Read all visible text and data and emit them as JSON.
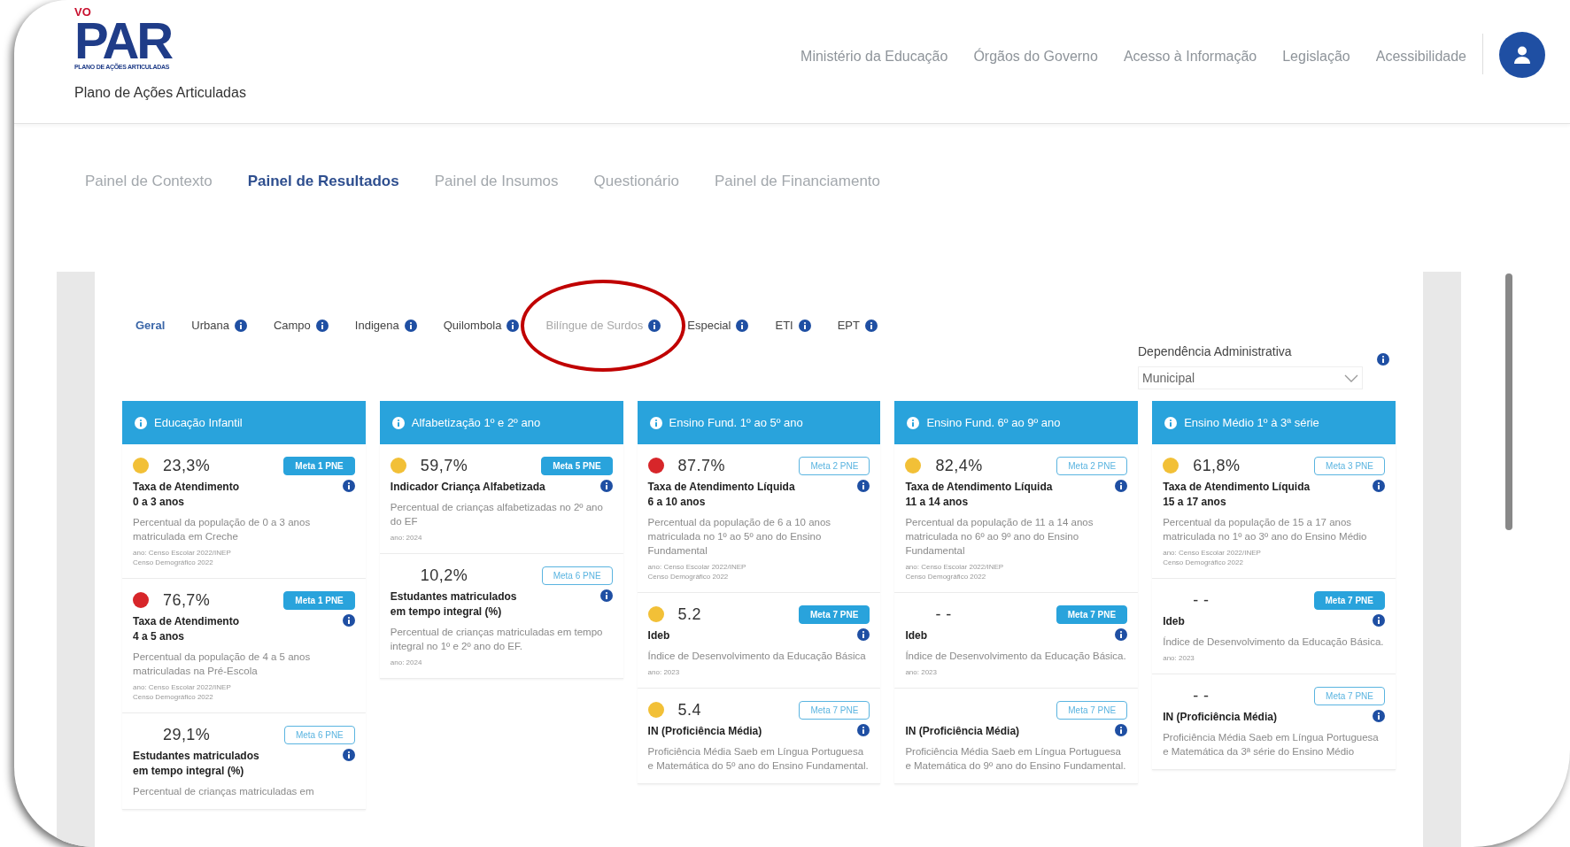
{
  "header": {
    "logo": {
      "top": "VO",
      "main": "PAR",
      "sub": "PLANO DE AÇÕES ARTICULADAS"
    },
    "subtitle": "Plano de Ações Articuladas",
    "nav_links": [
      "Ministério da Educação",
      "Órgãos do Governo",
      "Acesso à Informação",
      "Legislação",
      "Acessibilidade"
    ]
  },
  "tabs": [
    {
      "label": "Painel de Contexto",
      "selected": false
    },
    {
      "label": "Painel de Resultados",
      "selected": true
    },
    {
      "label": "Painel de Insumos",
      "selected": false
    },
    {
      "label": "Questionário",
      "selected": false
    },
    {
      "label": "Painel de Financiamento",
      "selected": false
    }
  ],
  "filters": [
    {
      "label": "Geral",
      "selected": true,
      "disabled": false,
      "info": false,
      "circled": false
    },
    {
      "label": "Urbana",
      "selected": false,
      "disabled": false,
      "info": true,
      "circled": false
    },
    {
      "label": "Campo",
      "selected": false,
      "disabled": false,
      "info": true,
      "circled": false
    },
    {
      "label": "Indigena",
      "selected": false,
      "disabled": false,
      "info": true,
      "circled": false
    },
    {
      "label": "Quilombola",
      "selected": false,
      "disabled": false,
      "info": true,
      "circled": false
    },
    {
      "label": "Bilíngue de Surdos",
      "selected": false,
      "disabled": true,
      "info": true,
      "circled": true
    },
    {
      "label": "Especial",
      "selected": false,
      "disabled": false,
      "info": true,
      "circled": false
    },
    {
      "label": "ETI",
      "selected": false,
      "disabled": false,
      "info": true,
      "circled": false
    },
    {
      "label": "EPT",
      "selected": false,
      "disabled": false,
      "info": true,
      "circled": false
    }
  ],
  "dependency": {
    "label": "Dependência Administrativa",
    "value": "Municipal"
  },
  "columns": [
    {
      "title": "Educação Infantil",
      "indicators": [
        {
          "color": "#f2c037",
          "value": "23,3%",
          "meta": "Meta 1 PNE",
          "meta_filled": true,
          "title_lines": [
            "Taxa de Atendimento",
            "0 a 3 anos"
          ],
          "description": "Percentual da população de 0 a 3 anos matriculada em Creche",
          "source_lines": [
            "ano: Censo Escolar 2022/INEP",
            "Censo Demográfico 2022"
          ]
        },
        {
          "color": "#d7262a",
          "value": "76,7%",
          "meta": "Meta 1 PNE",
          "meta_filled": true,
          "title_lines": [
            "Taxa de Atendimento",
            "4 a 5 anos"
          ],
          "description": "Percentual da população de 4 a 5 anos matriculadas na Pré-Escola",
          "source_lines": [
            "ano: Censo Escolar 2022/INEP",
            "Censo Demográfico 2022"
          ]
        },
        {
          "value": "29,1%",
          "meta": "Meta 6 PNE",
          "meta_filled": false,
          "title_lines": [
            "Estudantes matriculados",
            "em tempo integral (%)"
          ],
          "description": "Percentual de crianças matriculadas em"
        }
      ]
    },
    {
      "title": "Alfabetização 1º e 2º ano",
      "indicators": [
        {
          "color": "#f2c037",
          "value": "59,7%",
          "meta": "Meta 5 PNE",
          "meta_filled": true,
          "title_lines": [
            "Indicador Criança Alfabetizada"
          ],
          "description": "Percentual de crianças alfabetizadas no 2º ano do EF",
          "source_lines": [
            "ano: 2024"
          ]
        },
        {
          "value": "10,2%",
          "meta": "Meta 6 PNE",
          "meta_filled": false,
          "title_lines": [
            "Estudantes matriculados",
            "em tempo integral (%)"
          ],
          "description": "Percentual de crianças matriculadas em tempo integral no 1º e 2º ano do EF.",
          "source_lines": [
            "ano: 2024"
          ]
        }
      ]
    },
    {
      "title": "Ensino Fund. 1º ao 5º ano",
      "indicators": [
        {
          "color": "#d7262a",
          "value": "87.7%",
          "meta": "Meta 2 PNE",
          "meta_filled": false,
          "title_lines": [
            "Taxa de Atendimento Líquida",
            "6 a 10 anos"
          ],
          "description": "Percentual da população de 6 a 10 anos matriculada no 1º ao 5º ano do Ensino Fundamental",
          "source_lines": [
            "ano: Censo Escolar 2022/INEP",
            "Censo Demográfico 2022"
          ]
        },
        {
          "color": "#f2c037",
          "value": "5.2",
          "meta": "Meta 7 PNE",
          "meta_filled": true,
          "title_lines": [
            "Ideb"
          ],
          "description": "Índice de Desenvolvimento da Educação Básica",
          "source_lines": [
            "ano: 2023"
          ]
        },
        {
          "color": "#f2c037",
          "value": "5.4",
          "meta": "Meta 7 PNE",
          "meta_filled": false,
          "title_lines": [
            "IN (Proficiência Média)"
          ],
          "description": "Proficiência Média Saeb em Língua Portuguesa e Matemática do 5º ano do Ensino Fundamental."
        }
      ]
    },
    {
      "title": "Ensino Fund. 6º ao 9º ano",
      "indicators": [
        {
          "color": "#f2c037",
          "value": "82,4%",
          "meta": "Meta 2 PNE",
          "meta_filled": false,
          "title_lines": [
            "Taxa de Atendimento Líquida",
            "11 a 14 anos"
          ],
          "description": "Percentual da população de 11 a 14 anos matriculada no 6º ao 9º ano do Ensino Fundamental",
          "source_lines": [
            "ano: Censo Escolar 2022/INEP",
            "Censo Demográfico 2022"
          ]
        },
        {
          "value": "- -",
          "meta": "Meta 7 PNE",
          "meta_filled": true,
          "title_lines": [
            "Ideb"
          ],
          "description": "Índice de Desenvolvimento da Educação Básica.",
          "source_lines": [
            "ano: 2023"
          ]
        },
        {
          "meta": "Meta 7 PNE",
          "meta_filled": false,
          "title_lines": [
            "IN (Proficiência Média)"
          ],
          "description": "Proficiência Média Saeb em Língua Portuguesa e Matemática do 9º ano do Ensino Fundamental."
        }
      ]
    },
    {
      "title": "Ensino Médio 1º à 3ª série",
      "indicators": [
        {
          "color": "#f2c037",
          "value": "61,8%",
          "meta": "Meta 3 PNE",
          "meta_filled": false,
          "title_lines": [
            "Taxa de Atendimento Líquida",
            "15 a 17 anos"
          ],
          "description": "Percentual da população de 15 a 17 anos matriculada no 1º ao 3º ano do Ensino Médio",
          "source_lines": [
            "ano: Censo Escolar 2022/INEP",
            "Censo Demográfico 2022"
          ]
        },
        {
          "value": "- -",
          "meta": "Meta 7 PNE",
          "meta_filled": true,
          "title_lines": [
            "Ideb"
          ],
          "description": "Índice de Desenvolvimento da Educação Básica.",
          "source_lines": [
            "ano: 2023"
          ]
        },
        {
          "value": "- -",
          "meta": "Meta 7 PNE",
          "meta_filled": false,
          "title_lines": [
            "IN (Proficiência Média)"
          ],
          "description": "Proficiência Média Saeb em Língua Portuguesa e Matemática da 3ª série do Ensino Médio"
        }
      ]
    }
  ]
}
